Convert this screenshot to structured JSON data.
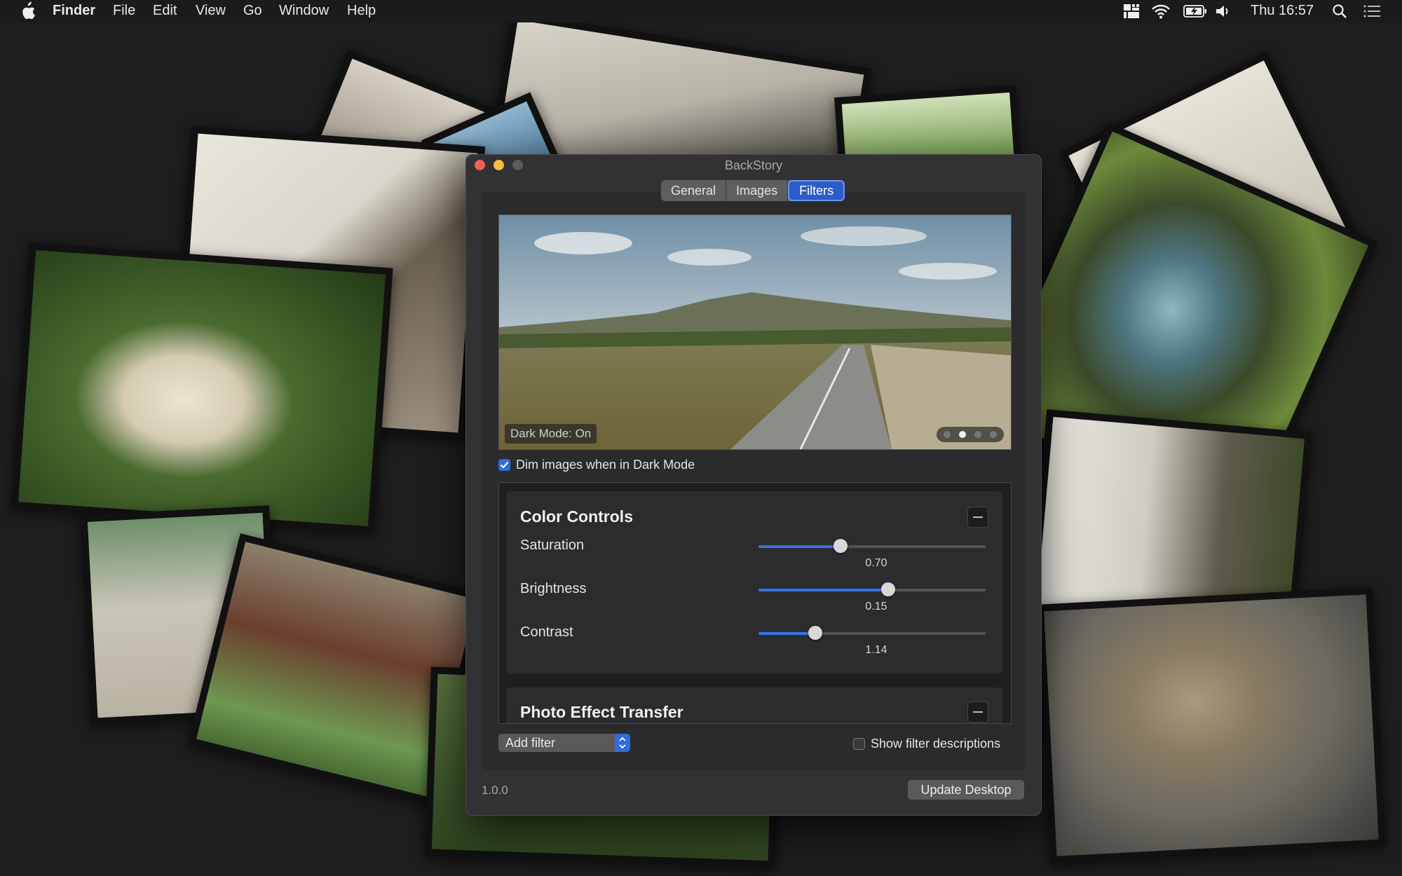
{
  "menubar": {
    "app_name": "Finder",
    "items": [
      "File",
      "Edit",
      "View",
      "Go",
      "Window",
      "Help"
    ],
    "clock": "Thu 16:57",
    "status_icons": [
      "grid-icon",
      "wifi-icon",
      "battery-icon",
      "volume-icon",
      "search-icon",
      "list-icon"
    ]
  },
  "window": {
    "title": "BackStory",
    "tabs": [
      "General",
      "Images",
      "Filters"
    ],
    "active_tab": "Filters",
    "preview": {
      "label": "Dark Mode: On",
      "page_count": 4,
      "current_page": 2
    },
    "dim_checkbox": {
      "label": "Dim images when in Dark Mode",
      "checked": true
    },
    "cards": {
      "color_controls": {
        "title": "Color Controls",
        "sliders": [
          {
            "label": "Saturation",
            "value": "0.70",
            "position": 0.36
          },
          {
            "label": "Brightness",
            "value": "0.15",
            "position": 0.57
          },
          {
            "label": "Contrast",
            "value": "1.14",
            "position": 0.25
          }
        ]
      },
      "photo_effect": {
        "title": "Photo Effect Transfer"
      }
    },
    "add_filter": {
      "label": "Add filter"
    },
    "show_descriptions": {
      "label": "Show filter descriptions",
      "checked": false
    },
    "version": "1.0.0",
    "update_button": "Update Desktop"
  },
  "colors": {
    "accent": "#2f6ae0",
    "close": "#ee5f57",
    "minimize": "#f5be3d",
    "zoom_disabled": "#5c5c5e"
  }
}
